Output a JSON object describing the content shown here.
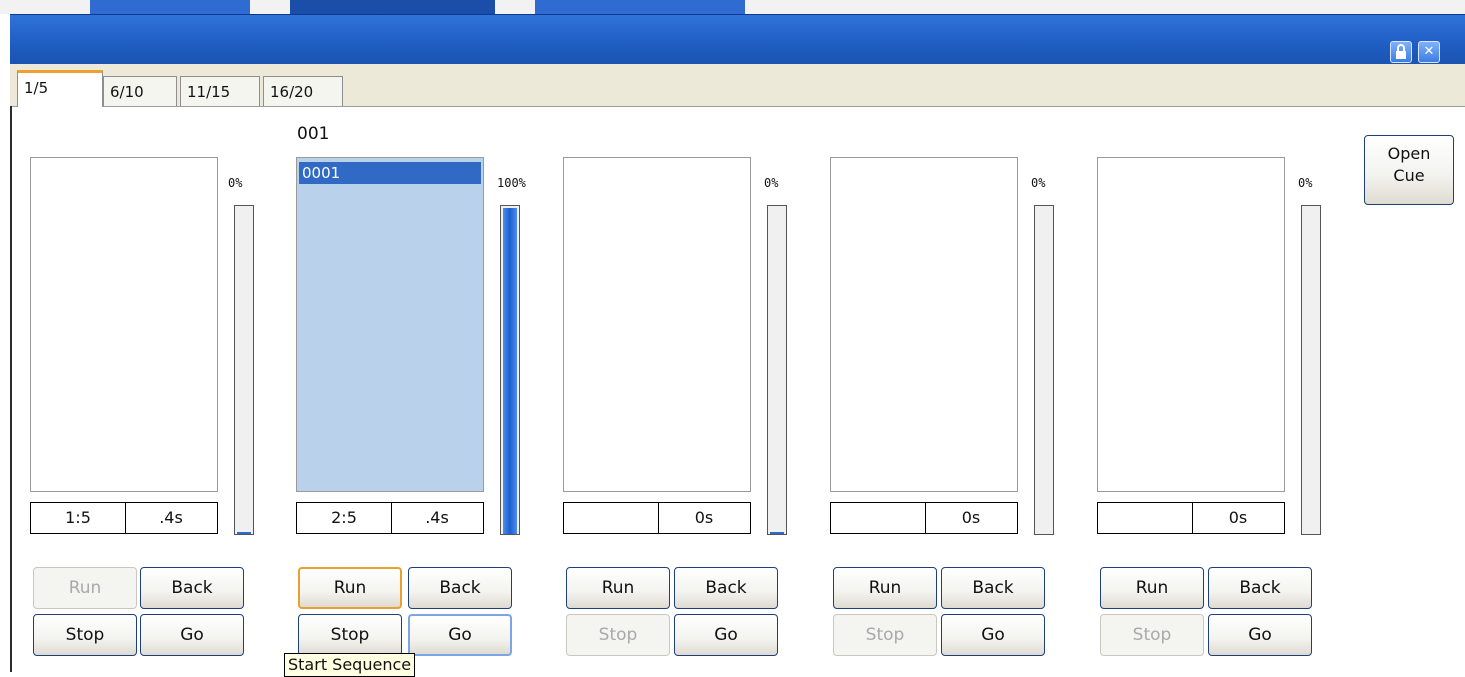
{
  "tabs": [
    {
      "label": "1/5",
      "active": true
    },
    {
      "label": "6/10",
      "active": false
    },
    {
      "label": "11/15",
      "active": false
    },
    {
      "label": "16/20",
      "active": false
    }
  ],
  "titlebar_buttons": {
    "lock_icon": "lock-icon",
    "close_icon": "close-icon"
  },
  "playbacks": [
    {
      "sequence_label": "",
      "list_items": [],
      "selected": false,
      "level_text": "0%",
      "level": 0.0,
      "cue": "1:5",
      "time": ".4s",
      "buttons": {
        "run": "Run",
        "back": "Back",
        "stop": "Stop",
        "go": "Go"
      },
      "run_enabled": false,
      "stop_enabled": true
    },
    {
      "sequence_label": "001",
      "list_items": [
        "0001"
      ],
      "selected": true,
      "level_text": "100%",
      "level": 1.0,
      "cue": "2:5",
      "time": ".4s",
      "buttons": {
        "run": "Run",
        "back": "Back",
        "stop": "Stop",
        "go": "Go"
      },
      "run_enabled": true,
      "stop_enabled": true
    },
    {
      "sequence_label": "",
      "list_items": [],
      "selected": false,
      "level_text": "0%",
      "level": 0.0,
      "cue": "",
      "time": "0s",
      "buttons": {
        "run": "Run",
        "back": "Back",
        "stop": "Stop",
        "go": "Go"
      },
      "run_enabled": true,
      "stop_enabled": false
    },
    {
      "sequence_label": "",
      "list_items": [],
      "selected": false,
      "level_text": "0%",
      "level": 0.0,
      "cue": "",
      "time": "0s",
      "buttons": {
        "run": "Run",
        "back": "Back",
        "stop": "Stop",
        "go": "Go"
      },
      "run_enabled": true,
      "stop_enabled": false
    },
    {
      "sequence_label": "",
      "list_items": [],
      "selected": false,
      "level_text": "0%",
      "level": 0.0,
      "cue": "",
      "time": "0s",
      "buttons": {
        "run": "Run",
        "back": "Back",
        "stop": "Stop",
        "go": "Go"
      },
      "run_enabled": true,
      "stop_enabled": false
    }
  ],
  "open_cue": {
    "line1": "Open",
    "line2": "Cue"
  },
  "tooltip": "Start Sequence",
  "colors": {
    "titlebar": "#1f5dc2",
    "selection": "#316ac5",
    "list_selected_bg": "#b9d1ea",
    "fader_fill": "#1c5fd0",
    "tab_accent": "#f0a030"
  }
}
